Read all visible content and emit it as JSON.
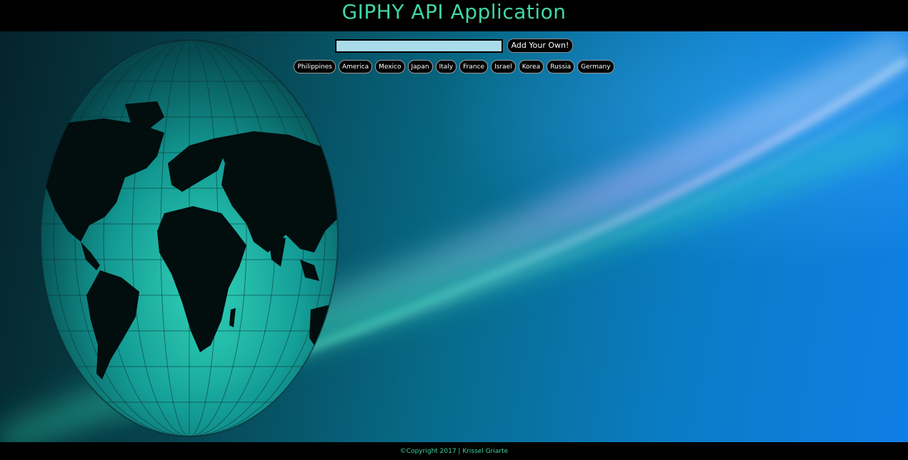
{
  "header": {
    "title": "GIPHY API Application"
  },
  "search": {
    "value": "",
    "placeholder": "",
    "add_button_label": "Add Your Own!"
  },
  "countries": [
    {
      "label": "Philippines"
    },
    {
      "label": "America"
    },
    {
      "label": "Mexico"
    },
    {
      "label": "Japan"
    },
    {
      "label": "Italy"
    },
    {
      "label": "France"
    },
    {
      "label": "Israel"
    },
    {
      "label": "Korea"
    },
    {
      "label": "Russia"
    },
    {
      "label": "Germany"
    }
  ],
  "footer": {
    "text": "©Copyright 2017 | Krissel Griarte"
  },
  "colors": {
    "accent": "#41d6a3",
    "input_bg": "#a9dbe9",
    "bar_bg": "#000000"
  },
  "background": {
    "image": "globe-on-blue-light-streak"
  }
}
